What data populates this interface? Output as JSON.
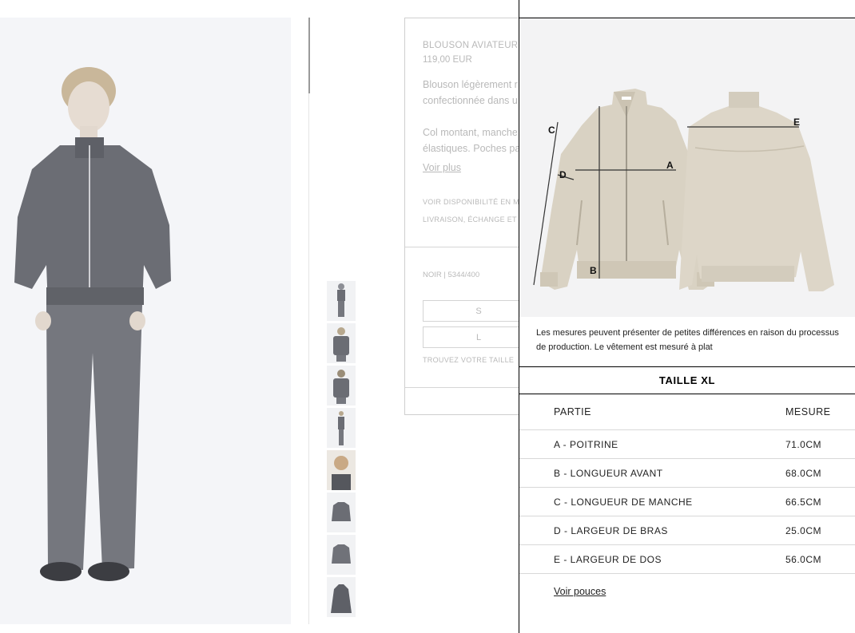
{
  "background_page": {
    "product_name": "BLOUSON AVIATEUR",
    "price": "119,00 EUR",
    "description_lines": [
      "Blouson légèrement r",
      "confectionnée dans u",
      "Col montant, manche",
      "élastiques. Poches pa"
    ],
    "see_more": "Voir plus",
    "availability_link": "VOIR DISPONIBILITÉ EN M",
    "shipping_link": "LIVRAISON, ÉCHANGE ET",
    "color_reference": "NOIR | 5344/400",
    "sizes": [
      "S",
      "L"
    ],
    "find_size": "TROUVEZ VOTRE TAILLE"
  },
  "size_guide": {
    "measurement_letters": [
      "A",
      "B",
      "C",
      "D",
      "E"
    ],
    "note": "Les mesures peuvent présenter de petites différences en raison du processus de production. Le vêtement est mesuré à plat",
    "size_title": "TAILLE XL",
    "table": {
      "headers": [
        "PARTIE",
        "MESURE"
      ],
      "rows": [
        {
          "part": "A - POITRINE",
          "measure": "71.0CM"
        },
        {
          "part": "B - LONGUEUR AVANT",
          "measure": "68.0CM"
        },
        {
          "part": "C - LONGUEUR DE MANCHE",
          "measure": "66.5CM"
        },
        {
          "part": "D - LARGEUR DE BRAS",
          "measure": "25.0CM"
        },
        {
          "part": "E - LARGEUR DE DOS",
          "measure": "56.0CM"
        }
      ]
    },
    "inches_link": "Voir pouces"
  },
  "colors": {
    "garment": "#d9d2c3",
    "garment_shadow": "#c7bfae",
    "jacket_dark": "#6b6d74",
    "pants_dark": "#75777e"
  }
}
